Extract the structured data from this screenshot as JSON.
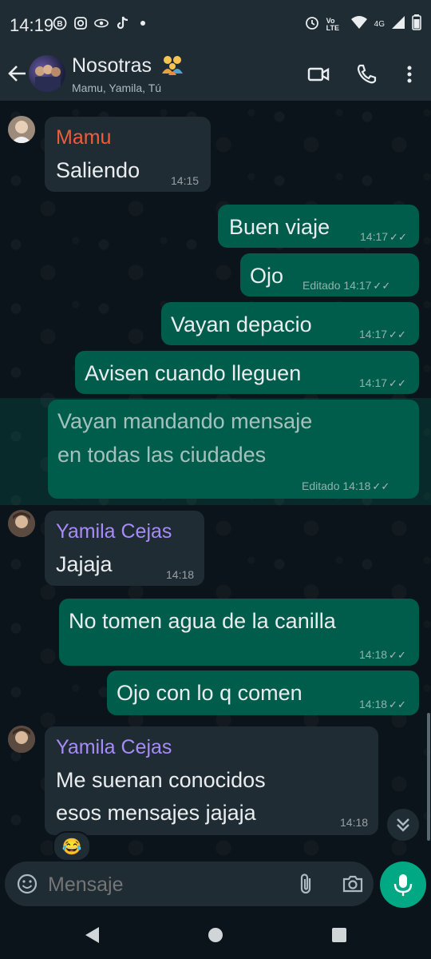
{
  "status_bar": {
    "time": "14:19",
    "network": "4G",
    "volte": "Vo LTE"
  },
  "chat": {
    "title": "Nosotras",
    "participants": "Mamu, Yamila, Tú"
  },
  "messages": [
    {
      "sender": "Mamu",
      "sender_color": "#f15c3a",
      "text": "Saliendo",
      "time": "14:15"
    },
    {
      "text": "Buen viaje",
      "time": "14:17",
      "ticks": "✓✓"
    },
    {
      "text": "Ojo",
      "edited": "Editado",
      "time": "14:17",
      "ticks": "✓✓"
    },
    {
      "text": "Vayan depacio",
      "time": "14:17",
      "ticks": "✓✓"
    },
    {
      "text": "Avisen cuando lleguen",
      "time": "14:17",
      "ticks": "✓✓"
    },
    {
      "text_line1": "Vayan mandando mensaje",
      "text_line2": "en todas las ciudades",
      "edited": "Editado",
      "time": "14:18",
      "ticks": "✓✓"
    },
    {
      "sender": "Yamila Cejas",
      "sender_color": "#a78bfa",
      "text": "Jajaja",
      "time": "14:18"
    },
    {
      "text": "No tomen agua de la canilla",
      "time": "14:18",
      "ticks": "✓✓"
    },
    {
      "text": "Ojo con lo q comen",
      "time": "14:18",
      "ticks": "✓✓"
    },
    {
      "sender": "Yamila Cejas",
      "sender_color": "#a78bfa",
      "text_line1": "Me suenan conocidos",
      "text_line2": "esos mensajes jajaja",
      "time": "14:18",
      "reaction": "😂"
    }
  ],
  "input": {
    "placeholder": "Mensaje"
  },
  "colors": {
    "accent": "#00a884",
    "outgoing": "#005c4b",
    "incoming": "#202c33",
    "header": "#1f2c34"
  }
}
